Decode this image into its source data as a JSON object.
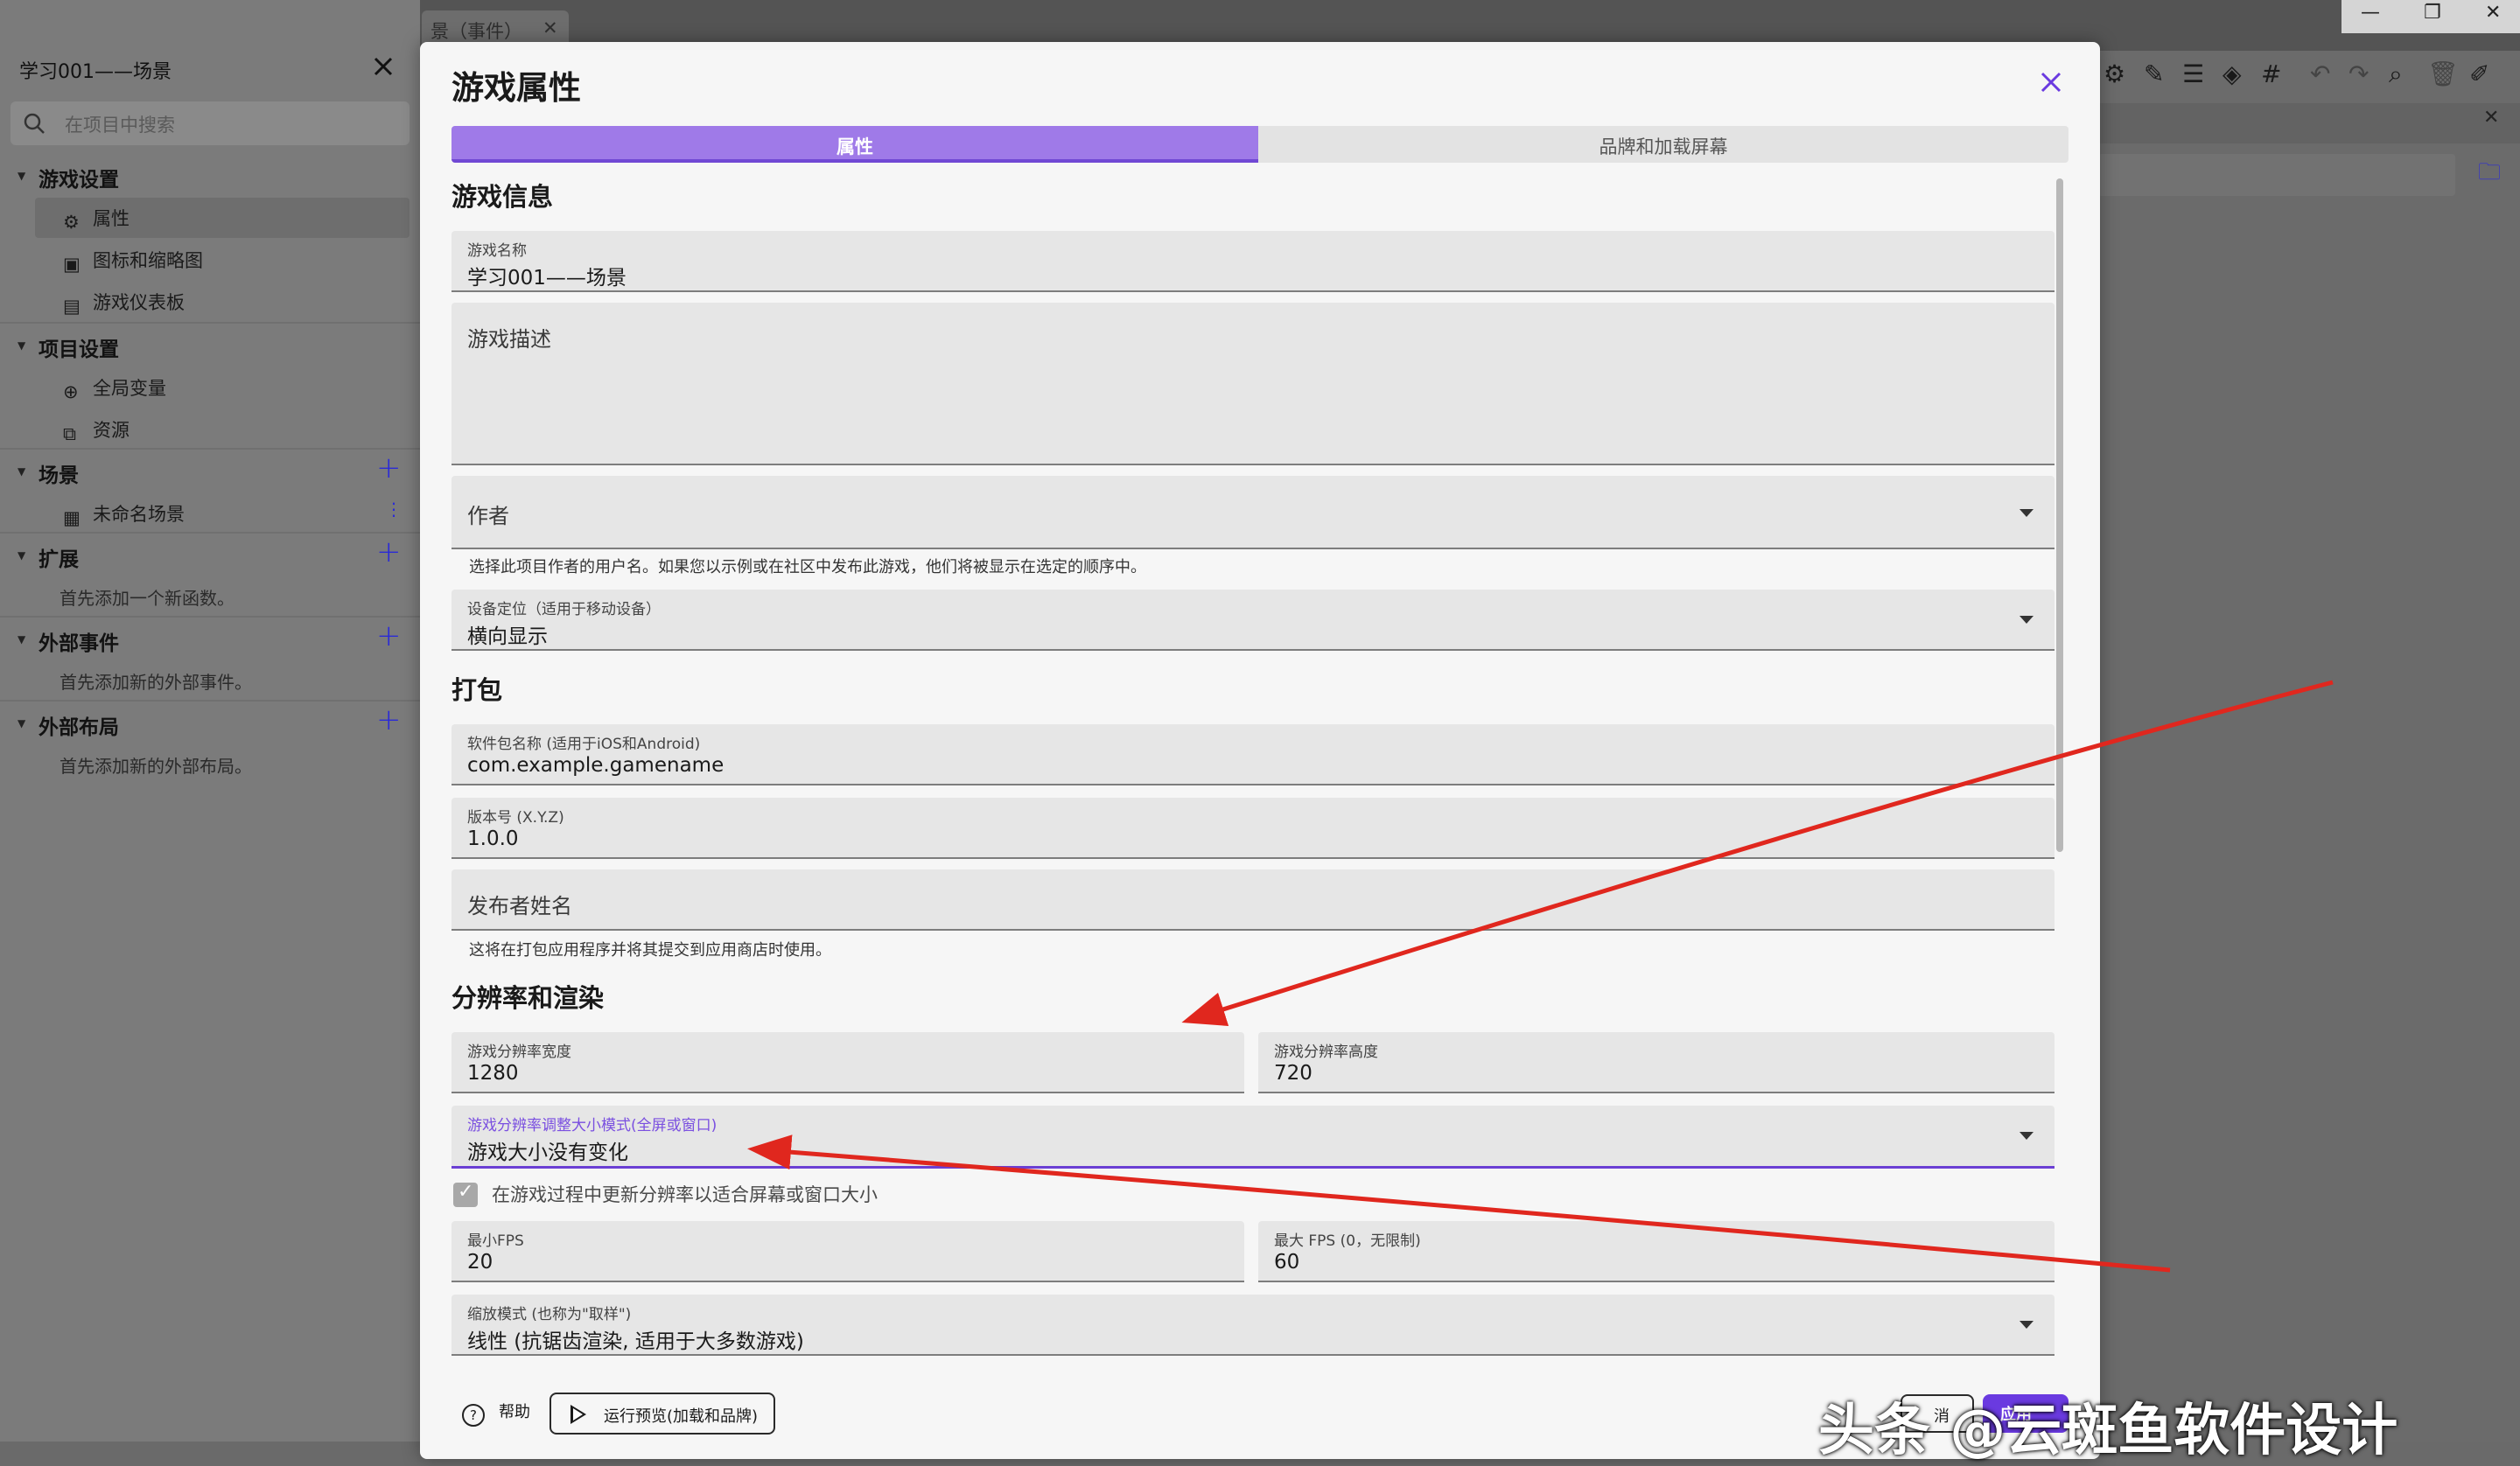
{
  "project": {
    "title": "学习001——场景",
    "search_placeholder": "在项目中搜索",
    "sections": {
      "game_settings": {
        "label": "游戏设置",
        "items": [
          "属性",
          "图标和缩略图",
          "游戏仪表板"
        ]
      },
      "project_settings": {
        "label": "项目设置",
        "items": [
          "全局变量",
          "资源"
        ]
      },
      "scenes": {
        "label": "场景",
        "items": [
          "未命名场景"
        ]
      },
      "extensions": {
        "label": "扩展",
        "hint": "首先添加一个新函数。"
      },
      "external_events": {
        "label": "外部事件",
        "hint": "首先添加新的外部事件。"
      },
      "external_layouts": {
        "label": "外部布局",
        "hint": "首先添加新的外部布局。"
      }
    }
  },
  "editor": {
    "tab_fragment": "景（事件）"
  },
  "dialog": {
    "title": "游戏属性",
    "tabs": [
      "属性",
      "品牌和加载屏幕"
    ],
    "sections": {
      "game_info": "游戏信息",
      "packaging": "打包",
      "resolution": "分辨率和渲染"
    },
    "fields": {
      "game_name": {
        "label": "游戏名称",
        "value": "学习001——场景"
      },
      "description": {
        "placeholder": "游戏描述"
      },
      "author": {
        "placeholder": "作者",
        "helper": "选择此项目作者的用户名。如果您以示例或在社区中发布此游戏，他们将被显示在选定的顺序中。"
      },
      "orientation": {
        "label": "设备定位（适用于移动设备）",
        "value": "横向显示"
      },
      "package_name": {
        "label": "软件包名称 (适用于iOS和Android)",
        "value": "com.example.gamename"
      },
      "version": {
        "label": "版本号 (X.Y.Z)",
        "value": "1.0.0"
      },
      "publisher": {
        "placeholder": "发布者姓名",
        "helper": "这将在打包应用程序并将其提交到应用商店时使用。"
      },
      "res_width": {
        "label": "游戏分辨率宽度",
        "value": "1280"
      },
      "res_height": {
        "label": "游戏分辨率高度",
        "value": "720"
      },
      "resize_mode": {
        "label": "游戏分辨率调整大小模式(全屏或窗口)",
        "value": "游戏大小没有变化"
      },
      "adapt_checkbox": {
        "label": "在游戏过程中更新分辨率以适合屏幕或窗口大小",
        "checked": true
      },
      "min_fps": {
        "label": "最小FPS",
        "value": "20"
      },
      "max_fps": {
        "label": "最大 FPS (0，无限制)",
        "value": "60"
      },
      "scale_mode": {
        "label": "缩放模式 (也称为\"取样\")",
        "value": "线性 (抗锯齿渲染, 适用于大多数游戏)"
      }
    },
    "footer": {
      "help": "帮助",
      "preview": "运行预览(加载和品牌)",
      "cancel": "消",
      "apply": "应用"
    }
  },
  "watermark": "头条 @云斑鱼软件设计",
  "colors": {
    "accent": "#9f7ae8",
    "accent_dark": "#6a3ae0",
    "annotation_arrow": "#e0271e"
  }
}
